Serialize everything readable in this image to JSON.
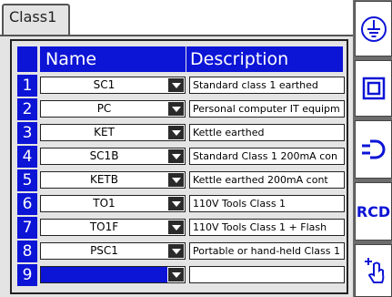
{
  "tab": {
    "label": "Class1"
  },
  "table": {
    "headers": {
      "name": "Name",
      "description": "Description"
    },
    "rows": [
      {
        "num": "1",
        "name": "SC1",
        "description": "Standard class 1 earthed"
      },
      {
        "num": "2",
        "name": "PC",
        "description": "Personal computer IT equipm"
      },
      {
        "num": "3",
        "name": "KET",
        "description": "Kettle earthed"
      },
      {
        "num": "4",
        "name": "SC1B",
        "description": "Standard Class 1 200mA con"
      },
      {
        "num": "5",
        "name": "KETB",
        "description": "Kettle earthed 200mA cont"
      },
      {
        "num": "6",
        "name": "TO1",
        "description": "110V Tools Class 1"
      },
      {
        "num": "7",
        "name": "TO1F",
        "description": "110V Tools Class 1 + Flash"
      },
      {
        "num": "8",
        "name": "PSC1",
        "description": "Portable or hand-held Class 1"
      },
      {
        "num": "9",
        "name": "",
        "description": ""
      }
    ]
  },
  "toolbar": {
    "buttons": [
      {
        "icon": "earth-icon",
        "label": ""
      },
      {
        "icon": "class2-insulation-icon",
        "label": ""
      },
      {
        "icon": "plug-icon",
        "label": ""
      },
      {
        "icon": "",
        "label": "RCD"
      },
      {
        "icon": "touch-probe-icon",
        "label": ""
      }
    ]
  },
  "colors": {
    "accent": "#0c14d6",
    "panel": "#e4e4e4",
    "toolbar": "#6c6c6c"
  }
}
